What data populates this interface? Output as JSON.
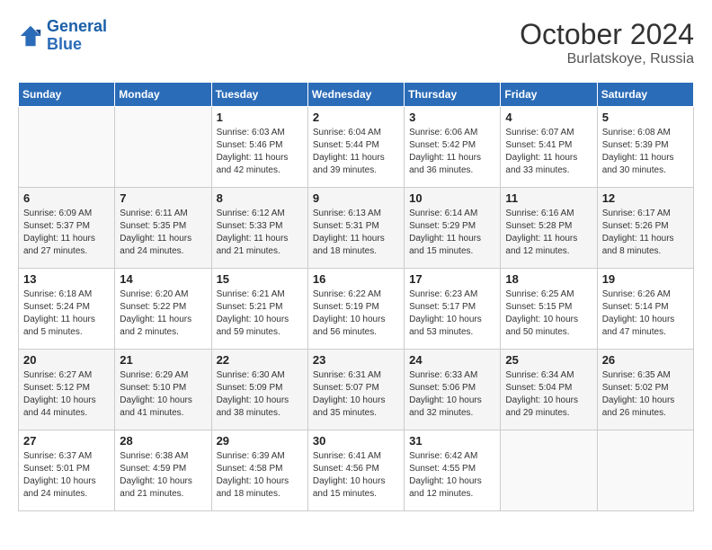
{
  "header": {
    "logo_line1": "General",
    "logo_line2": "Blue",
    "month_year": "October 2024",
    "location": "Burlatskoye, Russia"
  },
  "days_of_week": [
    "Sunday",
    "Monday",
    "Tuesday",
    "Wednesday",
    "Thursday",
    "Friday",
    "Saturday"
  ],
  "weeks": [
    [
      {
        "day": "",
        "info": ""
      },
      {
        "day": "",
        "info": ""
      },
      {
        "day": "1",
        "info": "Sunrise: 6:03 AM\nSunset: 5:46 PM\nDaylight: 11 hours and 42 minutes."
      },
      {
        "day": "2",
        "info": "Sunrise: 6:04 AM\nSunset: 5:44 PM\nDaylight: 11 hours and 39 minutes."
      },
      {
        "day": "3",
        "info": "Sunrise: 6:06 AM\nSunset: 5:42 PM\nDaylight: 11 hours and 36 minutes."
      },
      {
        "day": "4",
        "info": "Sunrise: 6:07 AM\nSunset: 5:41 PM\nDaylight: 11 hours and 33 minutes."
      },
      {
        "day": "5",
        "info": "Sunrise: 6:08 AM\nSunset: 5:39 PM\nDaylight: 11 hours and 30 minutes."
      }
    ],
    [
      {
        "day": "6",
        "info": "Sunrise: 6:09 AM\nSunset: 5:37 PM\nDaylight: 11 hours and 27 minutes."
      },
      {
        "day": "7",
        "info": "Sunrise: 6:11 AM\nSunset: 5:35 PM\nDaylight: 11 hours and 24 minutes."
      },
      {
        "day": "8",
        "info": "Sunrise: 6:12 AM\nSunset: 5:33 PM\nDaylight: 11 hours and 21 minutes."
      },
      {
        "day": "9",
        "info": "Sunrise: 6:13 AM\nSunset: 5:31 PM\nDaylight: 11 hours and 18 minutes."
      },
      {
        "day": "10",
        "info": "Sunrise: 6:14 AM\nSunset: 5:29 PM\nDaylight: 11 hours and 15 minutes."
      },
      {
        "day": "11",
        "info": "Sunrise: 6:16 AM\nSunset: 5:28 PM\nDaylight: 11 hours and 12 minutes."
      },
      {
        "day": "12",
        "info": "Sunrise: 6:17 AM\nSunset: 5:26 PM\nDaylight: 11 hours and 8 minutes."
      }
    ],
    [
      {
        "day": "13",
        "info": "Sunrise: 6:18 AM\nSunset: 5:24 PM\nDaylight: 11 hours and 5 minutes."
      },
      {
        "day": "14",
        "info": "Sunrise: 6:20 AM\nSunset: 5:22 PM\nDaylight: 11 hours and 2 minutes."
      },
      {
        "day": "15",
        "info": "Sunrise: 6:21 AM\nSunset: 5:21 PM\nDaylight: 10 hours and 59 minutes."
      },
      {
        "day": "16",
        "info": "Sunrise: 6:22 AM\nSunset: 5:19 PM\nDaylight: 10 hours and 56 minutes."
      },
      {
        "day": "17",
        "info": "Sunrise: 6:23 AM\nSunset: 5:17 PM\nDaylight: 10 hours and 53 minutes."
      },
      {
        "day": "18",
        "info": "Sunrise: 6:25 AM\nSunset: 5:15 PM\nDaylight: 10 hours and 50 minutes."
      },
      {
        "day": "19",
        "info": "Sunrise: 6:26 AM\nSunset: 5:14 PM\nDaylight: 10 hours and 47 minutes."
      }
    ],
    [
      {
        "day": "20",
        "info": "Sunrise: 6:27 AM\nSunset: 5:12 PM\nDaylight: 10 hours and 44 minutes."
      },
      {
        "day": "21",
        "info": "Sunrise: 6:29 AM\nSunset: 5:10 PM\nDaylight: 10 hours and 41 minutes."
      },
      {
        "day": "22",
        "info": "Sunrise: 6:30 AM\nSunset: 5:09 PM\nDaylight: 10 hours and 38 minutes."
      },
      {
        "day": "23",
        "info": "Sunrise: 6:31 AM\nSunset: 5:07 PM\nDaylight: 10 hours and 35 minutes."
      },
      {
        "day": "24",
        "info": "Sunrise: 6:33 AM\nSunset: 5:06 PM\nDaylight: 10 hours and 32 minutes."
      },
      {
        "day": "25",
        "info": "Sunrise: 6:34 AM\nSunset: 5:04 PM\nDaylight: 10 hours and 29 minutes."
      },
      {
        "day": "26",
        "info": "Sunrise: 6:35 AM\nSunset: 5:02 PM\nDaylight: 10 hours and 26 minutes."
      }
    ],
    [
      {
        "day": "27",
        "info": "Sunrise: 6:37 AM\nSunset: 5:01 PM\nDaylight: 10 hours and 24 minutes."
      },
      {
        "day": "28",
        "info": "Sunrise: 6:38 AM\nSunset: 4:59 PM\nDaylight: 10 hours and 21 minutes."
      },
      {
        "day": "29",
        "info": "Sunrise: 6:39 AM\nSunset: 4:58 PM\nDaylight: 10 hours and 18 minutes."
      },
      {
        "day": "30",
        "info": "Sunrise: 6:41 AM\nSunset: 4:56 PM\nDaylight: 10 hours and 15 minutes."
      },
      {
        "day": "31",
        "info": "Sunrise: 6:42 AM\nSunset: 4:55 PM\nDaylight: 10 hours and 12 minutes."
      },
      {
        "day": "",
        "info": ""
      },
      {
        "day": "",
        "info": ""
      }
    ]
  ]
}
